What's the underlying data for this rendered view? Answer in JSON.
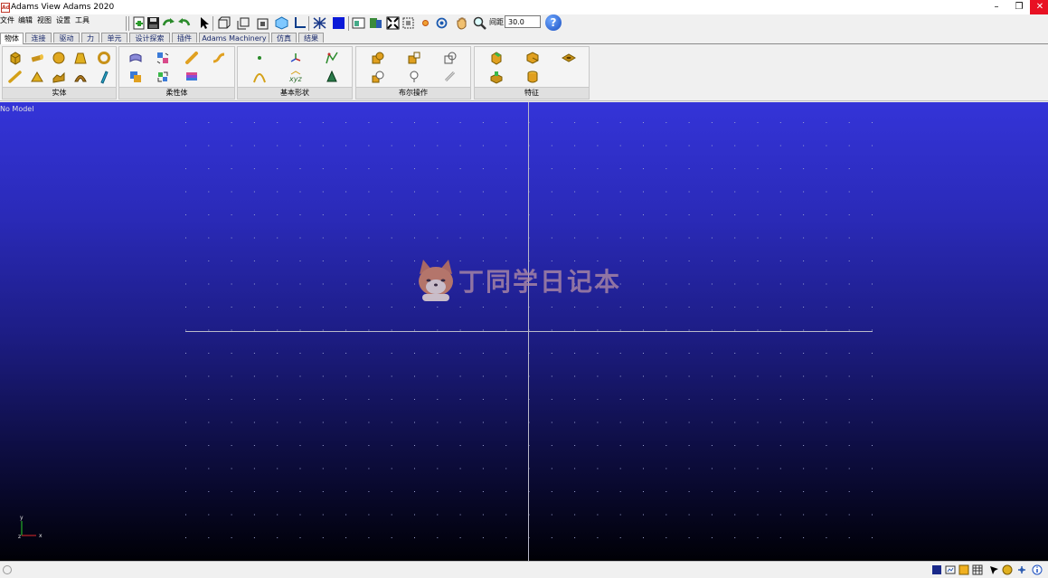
{
  "window": {
    "title": "Adams View Adams 2020",
    "app_icon_text": "Ad",
    "controls": {
      "minimize": "–",
      "maximize": "❐",
      "close": "✕"
    }
  },
  "menu": [
    "文件",
    "编辑",
    "视图",
    "设置",
    "工具"
  ],
  "toolbar": {
    "icons": [
      "new-icon",
      "save-icon",
      "redo-icon",
      "undo-icon",
      "select-arrow-icon",
      "front-view-icon",
      "back-view-icon",
      "fit-view-icon",
      "iso-view-icon",
      "axis-icon",
      "mesh-icon",
      "color-fill-icon",
      "render-mode-icon",
      "model-browser-icon",
      "fit-all-icon",
      "zoom-box-icon",
      "center-icon",
      "rotate-icon",
      "pan-hand-icon",
      "zoom-icon"
    ],
    "zoom_label": "间距",
    "zoom_value": "30.0",
    "help_symbol": "?"
  },
  "tabs": [
    "物体",
    "连接",
    "驱动",
    "力",
    "单元",
    "设计探索",
    "插件",
    "Adams Machinery",
    "仿真",
    "结果"
  ],
  "active_tab": "物体",
  "ribbon": {
    "groups": [
      {
        "label": "实体",
        "icons": [
          "box-icon",
          "cylinder-icon",
          "sphere-icon",
          "frustum-icon",
          "torus-icon",
          "link-icon",
          "cone-icon",
          "extrusion-icon",
          "revolution-icon",
          "plate-icon"
        ]
      },
      {
        "label": "柔性体",
        "icons": [
          "flex-body-icon",
          "flex-swap-icon",
          "flex-beam-icon",
          "flex-spring-icon",
          "flex-mnf-icon",
          "flex-convert-icon",
          "flex-colors-icon"
        ]
      },
      {
        "label": "基本形状",
        "icons": [
          "point-icon",
          "marker-icon",
          "polyline-icon",
          "arc-icon",
          "xyz-coordinate-icon",
          "cone-shape-icon"
        ]
      },
      {
        "label": "布尔操作",
        "icons": [
          "boolean-union-icon",
          "boolean-subtract-icon",
          "boolean-intersect-icon",
          "boolean-split-icon",
          "boolean-merge-icon",
          "boolean-chain-icon"
        ]
      },
      {
        "label": "特征",
        "icons": [
          "chamfer-icon",
          "fillet-icon",
          "hole-icon",
          "boss-icon",
          "hollow-icon"
        ]
      }
    ]
  },
  "viewport": {
    "model_label": "No Model",
    "triad": {
      "x_label": "x",
      "y_label": "y",
      "z_label": "z"
    },
    "watermark_text": "丁同学日记本"
  },
  "statusbar": {
    "icons": [
      "status-left-icon",
      "icon-view-toggle-icon",
      "graphics-window-icon",
      "lock-icon",
      "table-icon",
      "arrow-tool-icon",
      "render-sphere-icon",
      "coordinate-icon",
      "info-icon"
    ]
  }
}
